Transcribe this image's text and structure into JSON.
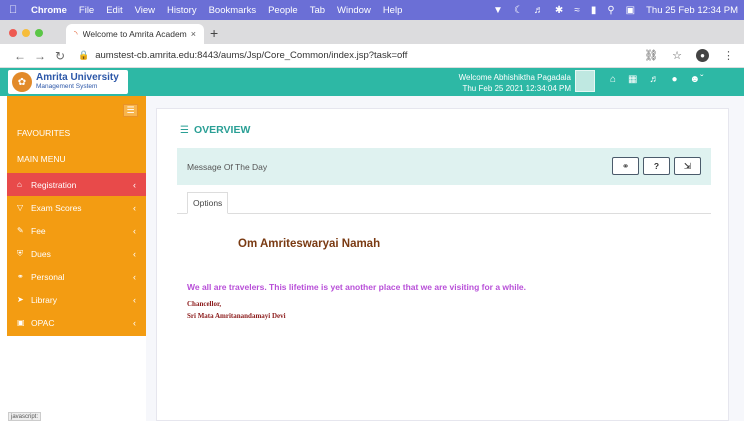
{
  "mac_menu": {
    "app": "Chrome",
    "items": [
      "File",
      "Edit",
      "View",
      "History",
      "Bookmarks",
      "People",
      "Tab",
      "Window",
      "Help"
    ],
    "clock": "Thu 25 Feb  12:34 PM"
  },
  "browser": {
    "tab_title": "Welcome to Amrita Academic I",
    "tab_close": "×",
    "new_tab": "+",
    "url": "aumstest-cb.amrita.edu:8443/aums/Jsp/Core_Common/index.jsp?task=off"
  },
  "header": {
    "logo_line1": "Amrita University",
    "logo_line2": "Management System",
    "welcome": "Welcome Abhishiktha Pagadala",
    "datetime": "Thu Feb 25 2021 12:34:04 PM",
    "accent": "#2db8a5"
  },
  "sidebar": {
    "favourites": "FAVOURITES",
    "main_menu": "MAIN MENU",
    "bg": "#f39c12",
    "items": [
      {
        "label": "Registration",
        "icon": "home-icon",
        "active": true
      },
      {
        "label": "Exam Scores",
        "icon": "funnel-icon"
      },
      {
        "label": "Fee",
        "icon": "pencil-icon"
      },
      {
        "label": "Dues",
        "icon": "shield-icon"
      },
      {
        "label": "Personal",
        "icon": "user-icon"
      },
      {
        "label": "Library",
        "icon": "send-icon"
      },
      {
        "label": "OPAC",
        "icon": "calendar-icon"
      }
    ],
    "copy_button": "javascript:"
  },
  "main": {
    "title": "OVERVIEW",
    "panel_title": "Message Of The Day",
    "panel_buttons": [
      "link-icon",
      "help-icon",
      "expand-icon"
    ],
    "help_label": "?",
    "tab_label": "Options",
    "om_line": "Om Amriteswaryai Namah",
    "quote": "We all are travelers. This lifetime is yet another place that we are visiting for a while.",
    "signature_title": "Chancellor,",
    "signature_name": "Sri Mata Amritanandamayi Devi"
  }
}
